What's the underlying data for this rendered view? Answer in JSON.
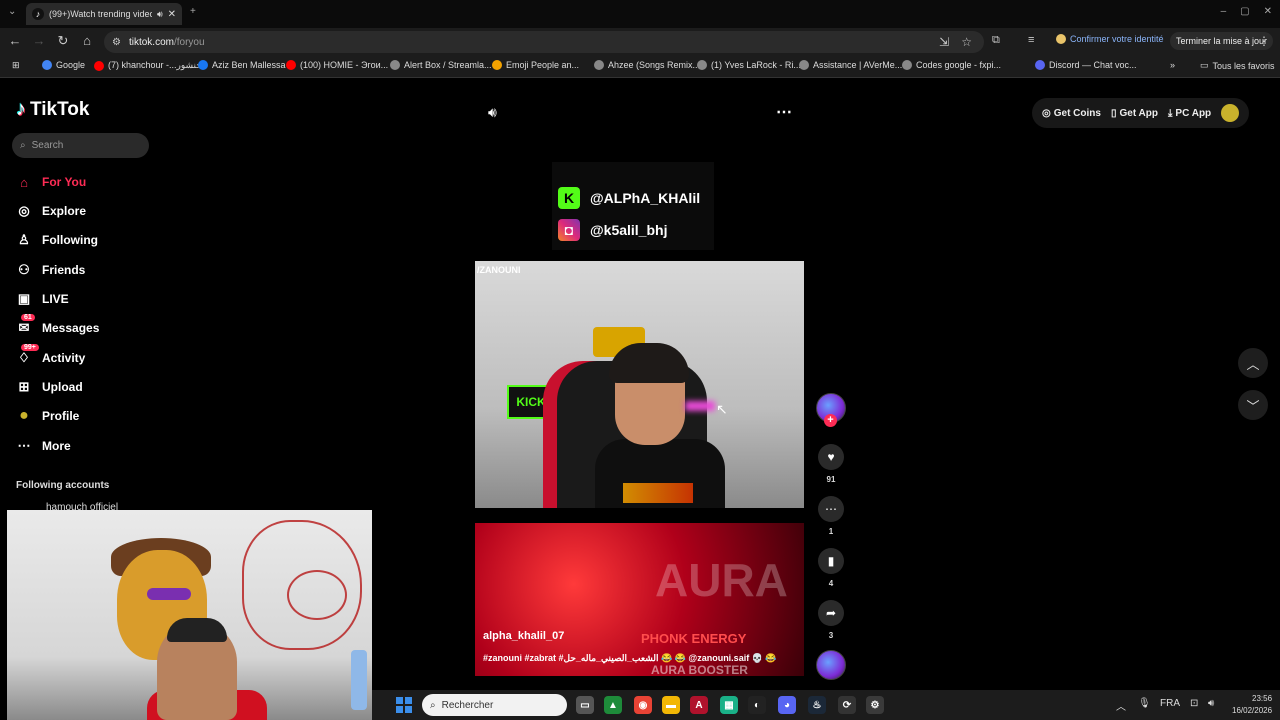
{
  "browser": {
    "tab_title": "(99+)Watch trending video",
    "url_host": "tiktok.com",
    "url_path": "/foryou",
    "identity_label": "Confirmer votre identité",
    "update_label": "Terminer la mise à jour",
    "all_bookmarks_label": "Tous les favoris",
    "bookmarks": [
      {
        "label": "Google",
        "color": "#4285f4"
      },
      {
        "label": "(7) khanchour -...خنشور",
        "color": "#ff0000"
      },
      {
        "label": "Aziz Ben Mallessa",
        "color": "#1877f2"
      },
      {
        "label": "(100) HOMIE - Эгои...",
        "color": "#ff0000"
      },
      {
        "label": "Alert Box / Streamla...",
        "color": "#888888"
      },
      {
        "label": "Emoji People an...",
        "color": "#f4a300"
      },
      {
        "label": "Ahzee (Songs Remix...",
        "color": "#888888"
      },
      {
        "label": "(1) Yves LaRock - Ri...",
        "color": "#888888"
      },
      {
        "label": "Assistance | AVerMe...",
        "color": "#888888"
      },
      {
        "label": "Codes google - fxpi...",
        "color": "#888888"
      },
      {
        "label": "Discord — Chat voc...",
        "color": "#5865f2"
      }
    ]
  },
  "tiktok": {
    "logo": "TikTok",
    "search_placeholder": "Search",
    "nav": [
      {
        "label": "For You",
        "icon": "home-icon",
        "glyph": "⌂",
        "active": true
      },
      {
        "label": "Explore",
        "icon": "compass-icon",
        "glyph": "◎"
      },
      {
        "label": "Following",
        "icon": "following-icon",
        "glyph": "♙"
      },
      {
        "label": "Friends",
        "icon": "friends-icon",
        "glyph": "⚇"
      },
      {
        "label": "LIVE",
        "icon": "live-icon",
        "glyph": "▣"
      },
      {
        "label": "Messages",
        "icon": "messages-icon",
        "glyph": "✉",
        "badge": "61"
      },
      {
        "label": "Activity",
        "icon": "activity-icon",
        "glyph": "♢",
        "badge": "99+"
      },
      {
        "label": "Upload",
        "icon": "upload-icon",
        "glyph": "⊞"
      },
      {
        "label": "Profile",
        "icon": "profile-avatar",
        "glyph": "●"
      },
      {
        "label": "More",
        "icon": "more-icon",
        "glyph": "⋯"
      }
    ],
    "following_accounts_label": "Following accounts",
    "following_account_peek": "hamouch officiel",
    "top_actions": {
      "coins": "Get Coins",
      "app": "Get App",
      "pc_app": "PC App"
    },
    "video": {
      "kick_handle": "@ALPhA_KHAlil",
      "insta_handle": "@k5alil_bhj",
      "watermark": "/ZANOUNI",
      "kick_text": "KICK",
      "likes": "91",
      "comments": "1",
      "saves": "4",
      "shares": "3"
    },
    "next_video": {
      "author": "alpha_khalil_07",
      "big_text": "AURA",
      "phonk": "PHONK ENERGY",
      "booster": "AURA BOOSTER",
      "caption": "#zanouni #zabrat #الشعب_الصيني_ماله_حل 😂 😂 @zanouni.saif 💀 😂"
    }
  },
  "taskbar": {
    "search_placeholder": "Rechercher",
    "lang": "FRA",
    "time": "23:56",
    "date": "16/02/2026"
  }
}
